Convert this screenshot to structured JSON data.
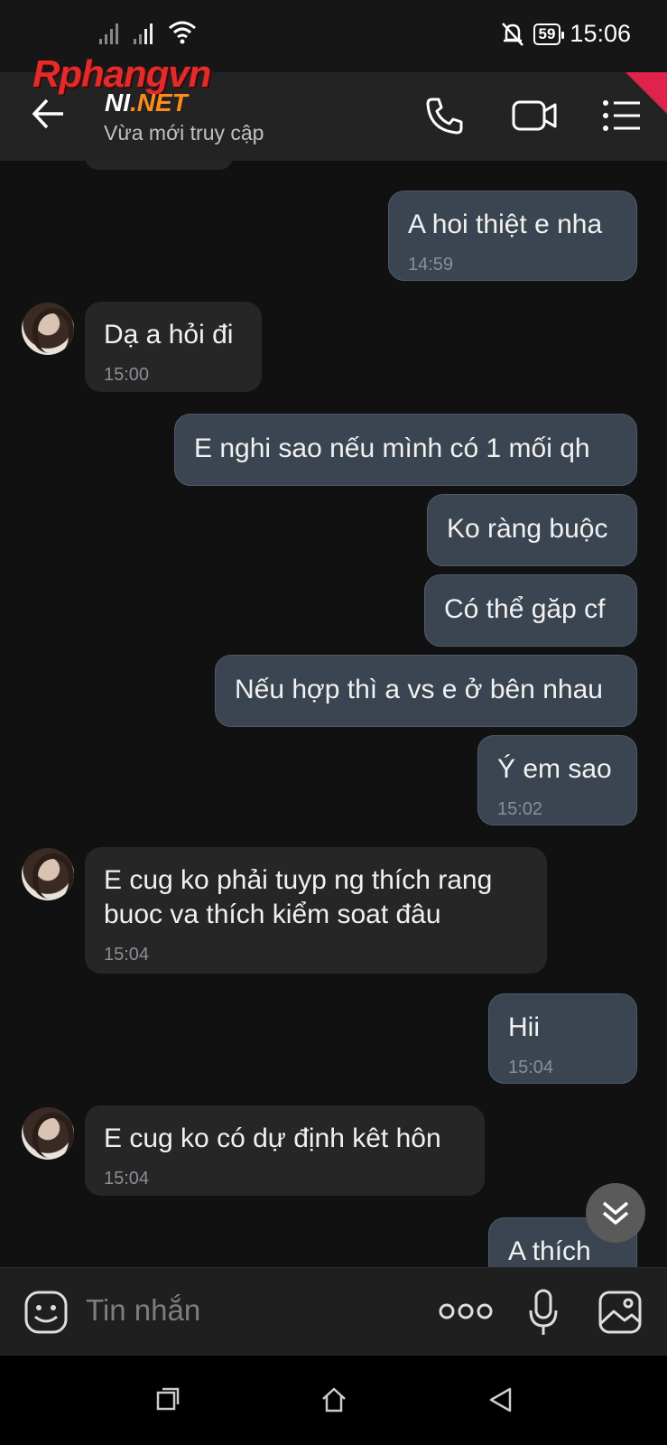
{
  "status_bar": {
    "time": "15:06",
    "battery": "59"
  },
  "header": {
    "watermark_top": "Rphangvn",
    "watermark_ni": "NI",
    "watermark_net": ".NET",
    "last_seen": "Vừa mới truy cập"
  },
  "messages": [
    {
      "side": "sent",
      "text": "A hoi thiệt e nha",
      "time": "14:59"
    },
    {
      "side": "recv",
      "text": "Dạ a hỏi đi",
      "time": "15:00"
    },
    {
      "side": "sent",
      "text": "E nghi sao nếu mình có 1 mối qh",
      "time": ""
    },
    {
      "side": "sent",
      "text": "Ko ràng buộc",
      "time": ""
    },
    {
      "side": "sent",
      "text": "Có thể găp cf",
      "time": ""
    },
    {
      "side": "sent",
      "text": "Nếu hợp thì a vs e ở bên nhau",
      "time": ""
    },
    {
      "side": "sent",
      "text": "Ý em sao",
      "time": "15:02"
    },
    {
      "side": "recv",
      "text": "E cug ko phải tuyp ng thích rang buoc va thích kiểm soat đâu",
      "time": "15:04"
    },
    {
      "side": "sent",
      "text": "Hii",
      "time": "15:04"
    },
    {
      "side": "recv",
      "text": "E cug ko có dự định kêt hôn",
      "time": "15:04"
    },
    {
      "side": "sent",
      "text": "A thích",
      "time": ""
    }
  ],
  "input": {
    "placeholder": "Tin nhắn"
  },
  "icons": {
    "back": "back-arrow-icon",
    "call": "phone-icon",
    "video": "video-call-icon",
    "menu": "menu-icon",
    "emoji": "emoji-icon",
    "more": "more-dots-icon",
    "mic": "microphone-icon",
    "gallery": "image-icon",
    "scroll": "chevron-double-down-icon"
  },
  "colors": {
    "sent_bubble": "#3b4451",
    "recv_bubble": "#262626",
    "background": "#111111",
    "watermark_red": "#e62929",
    "watermark_orange": "#ff8c1a"
  }
}
